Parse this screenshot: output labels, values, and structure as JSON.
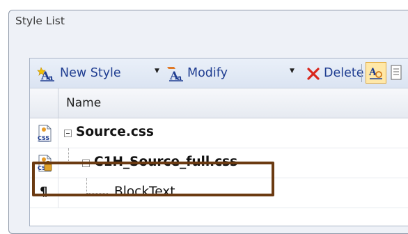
{
  "window": {
    "title": "Style List"
  },
  "toolbar": {
    "new_style_label": "New Style",
    "modify_label": "Modify",
    "delete_label": "Delete",
    "new_style_icon": "new-style-icon",
    "modify_icon": "modify-style-icon",
    "delete_icon": "delete-x-icon",
    "delete_color": "#d9261c",
    "toggle_pressed": true
  },
  "list": {
    "column_header": "Name",
    "rows": [
      {
        "label": "Source.css",
        "icon": "css-file-icon",
        "expanded": true,
        "bold": true
      },
      {
        "label": "C1H_Source_full.css",
        "icon": "css-file-locked-icon",
        "expanded": true,
        "bold": true,
        "highlighted": true
      },
      {
        "label": "BlockText",
        "icon": "paragraph-icon",
        "bold": false
      }
    ],
    "paragraph_glyph": "¶"
  },
  "colors": {
    "link_blue": "#1f3d91",
    "highlight_brown": "#6b3a11",
    "toolbar_bg": "#dbe4f2"
  }
}
